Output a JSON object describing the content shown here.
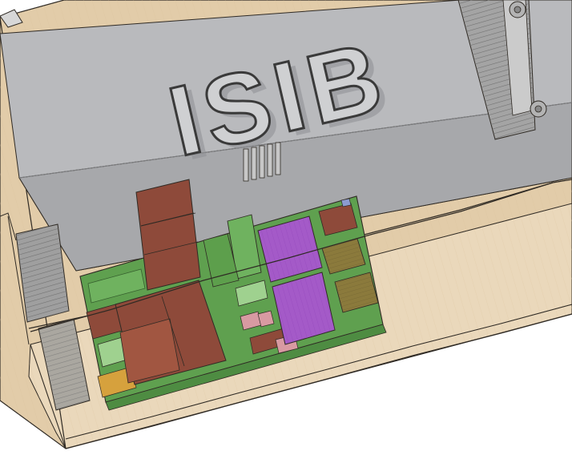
{
  "scene": {
    "logo_text": "ISIB",
    "colors": {
      "background": "#ffffff",
      "enclosure_wood": "#e2cca9",
      "enclosure_wood_light": "#ead8bb",
      "edge_line": "#2f2a24",
      "transformer_gray": "#b9babd",
      "transformer_gray_dark": "#a7a8ab",
      "pcb_green": "#5fa04f",
      "pcb_green_dark": "#4e8c42",
      "component_red_brown": "#8e4a3a",
      "component_purple": "#a45ac8",
      "component_olive": "#8b7a3c",
      "heatsink_gray": "#9f9f9f",
      "light_green": "#9fd18f",
      "pink": "#d89aa2"
    },
    "parts": [
      "enclosure-base",
      "transformer-block",
      "isib-logo",
      "pcb-board",
      "heatsink-left",
      "heatsink-top-right",
      "capacitor-stack",
      "purple-ic-top",
      "purple-ic-bottom"
    ]
  }
}
